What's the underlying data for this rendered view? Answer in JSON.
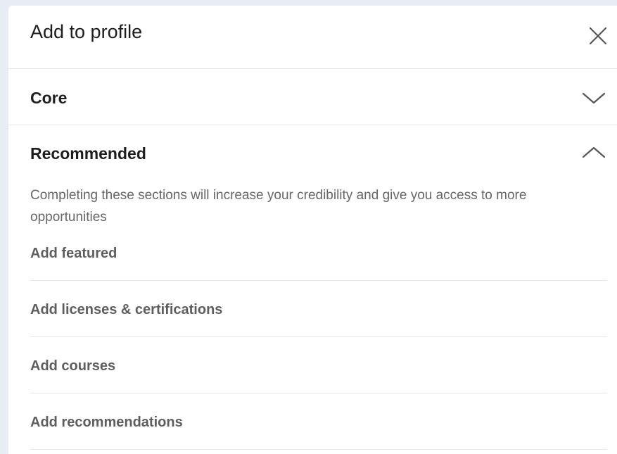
{
  "modal": {
    "title": "Add to profile",
    "close_icon": "close-icon"
  },
  "sections": {
    "core": {
      "label": "Core",
      "state": "collapsed",
      "icon": "chevron-down-icon"
    },
    "recommended": {
      "label": "Recommended",
      "state": "expanded",
      "icon": "chevron-up-icon",
      "description": "Completing these sections will increase your credibility and give you access to more opportunities",
      "items": [
        {
          "label": "Add featured"
        },
        {
          "label": "Add licenses & certifications"
        },
        {
          "label": "Add courses"
        },
        {
          "label": "Add recommendations"
        }
      ]
    }
  },
  "colors": {
    "background": "#e8ecf4",
    "panel": "#ffffff",
    "text_primary": "#1d1d1d",
    "text_secondary": "#666666",
    "item_text": "#5e5e5e",
    "divider": "#e6e6e6"
  }
}
